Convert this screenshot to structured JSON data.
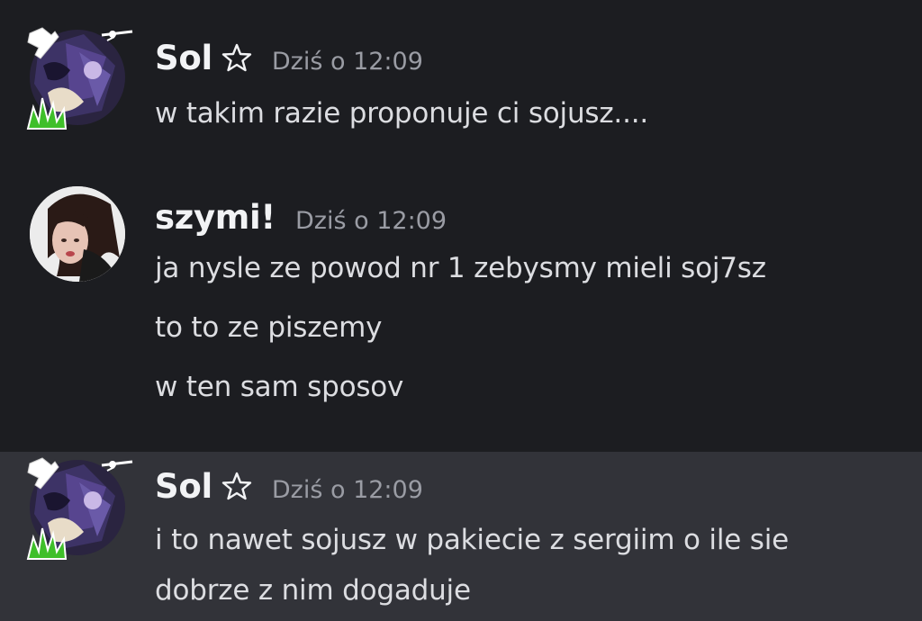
{
  "messages": [
    {
      "author": "Sol",
      "timestamp": "Dziś o 12:09",
      "lines": [
        "w takim razie proponuje ci sojusz...."
      ]
    },
    {
      "author": "szymi!",
      "timestamp": "Dziś o 12:09",
      "lines": [
        "ja nysle ze powod nr 1 zebysmy mieli soj7sz",
        "to to ze piszemy",
        "w ten sam sposov"
      ]
    },
    {
      "author": "Sol",
      "timestamp": "Dziś o 12:09",
      "lines": [
        "i to nawet sojusz w pakiecie z sergiim o ile sie",
        "dobrze z nim dogaduje"
      ]
    }
  ],
  "colors": {
    "background": "#1c1d21",
    "highlight_background": "#323339",
    "username": "#f2f3f5",
    "timestamp": "#9a9ca4",
    "message_text": "#dcdde1"
  },
  "icons": {
    "author_badge": "star-outline-icon"
  }
}
